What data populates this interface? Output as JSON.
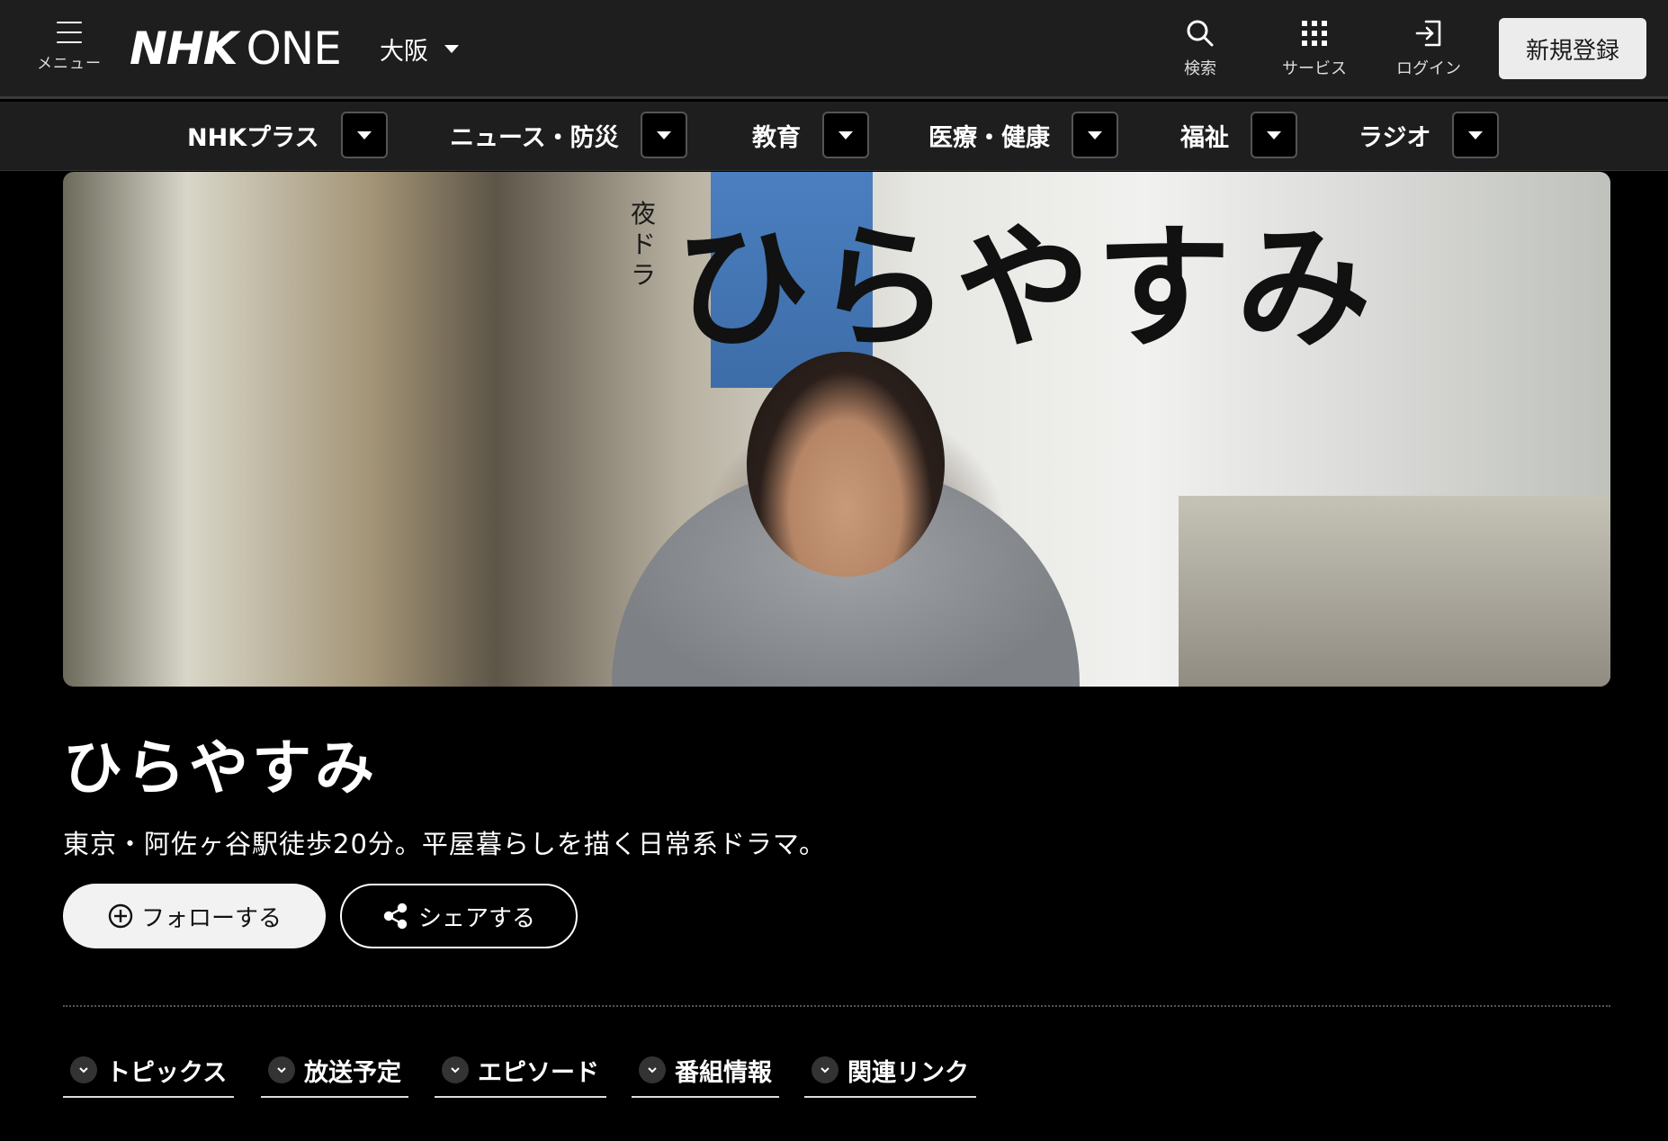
{
  "header": {
    "menu_label": "メニュー",
    "logo_nhk": "NHK",
    "logo_one": "ONE",
    "region": "大阪",
    "search_label": "検索",
    "services_label": "サービス",
    "login_label": "ログイン",
    "signup_label": "新規登録"
  },
  "categories": [
    {
      "label": "NHKプラス"
    },
    {
      "label": "ニュース・防災"
    },
    {
      "label": "教育"
    },
    {
      "label": "医療・健康"
    },
    {
      "label": "福祉"
    },
    {
      "label": "ラジオ"
    }
  ],
  "hero": {
    "tag": "夜ドラ",
    "title": "ひらやすみ"
  },
  "program": {
    "title": "ひらやすみ",
    "description": "東京・阿佐ヶ谷駅徒歩20分。平屋暮らしを描く日常系ドラマ。",
    "follow_label": "フォローする",
    "share_label": "シェアする"
  },
  "anchors": [
    {
      "label": "トピックス"
    },
    {
      "label": "放送予定"
    },
    {
      "label": "エピソード"
    },
    {
      "label": "番組情報"
    },
    {
      "label": "関連リンク"
    }
  ],
  "colors": {
    "header_bg": "#1e1e1e",
    "page_bg": "#000000",
    "signup_bg": "#ececec"
  }
}
